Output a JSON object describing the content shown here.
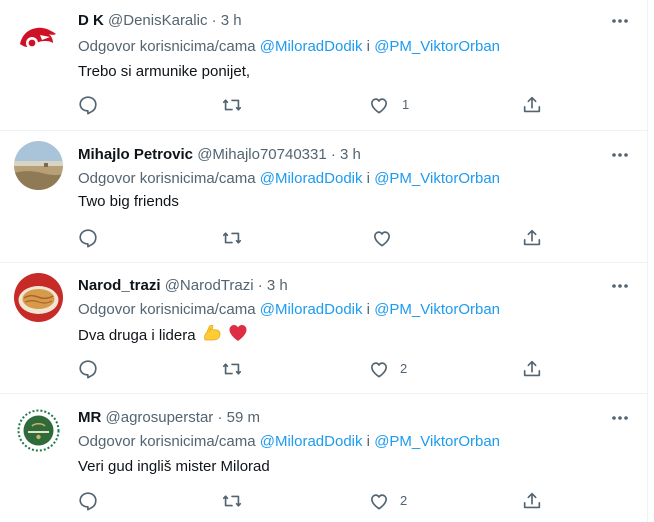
{
  "colors": {
    "accent": "#1d9bf0",
    "muted": "#536471",
    "text": "#0f1419",
    "heart": "#e0245e"
  },
  "tweets": [
    {
      "name": "D K",
      "handle": "@DenisKaralic",
      "sep": "·",
      "time": "3 h",
      "reply_prefix": "Odgovor korisnicima/cama",
      "mention1": "@MiloradDodik",
      "conj": "i",
      "mention2": "@PM_ViktorOrban",
      "text": "Trebo si armunike ponijet,",
      "like_count": "1",
      "avatar_icon": "red-wings-logo-avatar"
    },
    {
      "name": "Mihajlo Petrovic",
      "handle": "@Mihajlo70740331",
      "sep": "·",
      "time": "3 h",
      "reply_prefix": "Odgovor korisnicima/cama",
      "mention1": "@MiloradDodik",
      "conj": "i",
      "mention2": "@PM_ViktorOrban",
      "text": "Two big friends",
      "like_count": "",
      "avatar_icon": "landscape-photo-avatar"
    },
    {
      "name": "Narod_trazi",
      "handle": "@NarodTrazi",
      "sep": "·",
      "time": "3 h",
      "reply_prefix": "Odgovor korisnicima/cama",
      "mention1": "@MiloradDodik",
      "conj": "i",
      "mention2": "@PM_ViktorOrban",
      "text": "Dva druga i lidera",
      "emoji": [
        "flexed-biceps-emoji",
        "red-heart-emoji"
      ],
      "like_count": "2",
      "avatar_icon": "food-photo-avatar"
    },
    {
      "name": "MR",
      "handle": "@agrosuperstar",
      "sep": "·",
      "time": "59 m",
      "reply_prefix": "Odgovor korisnicima/cama",
      "mention1": "@MiloradDodik",
      "conj": "i",
      "mention2": "@PM_ViktorOrban",
      "text": "Veri gud ingliš mister Milorad",
      "like_count": "2",
      "avatar_icon": "green-emblem-avatar"
    }
  ]
}
